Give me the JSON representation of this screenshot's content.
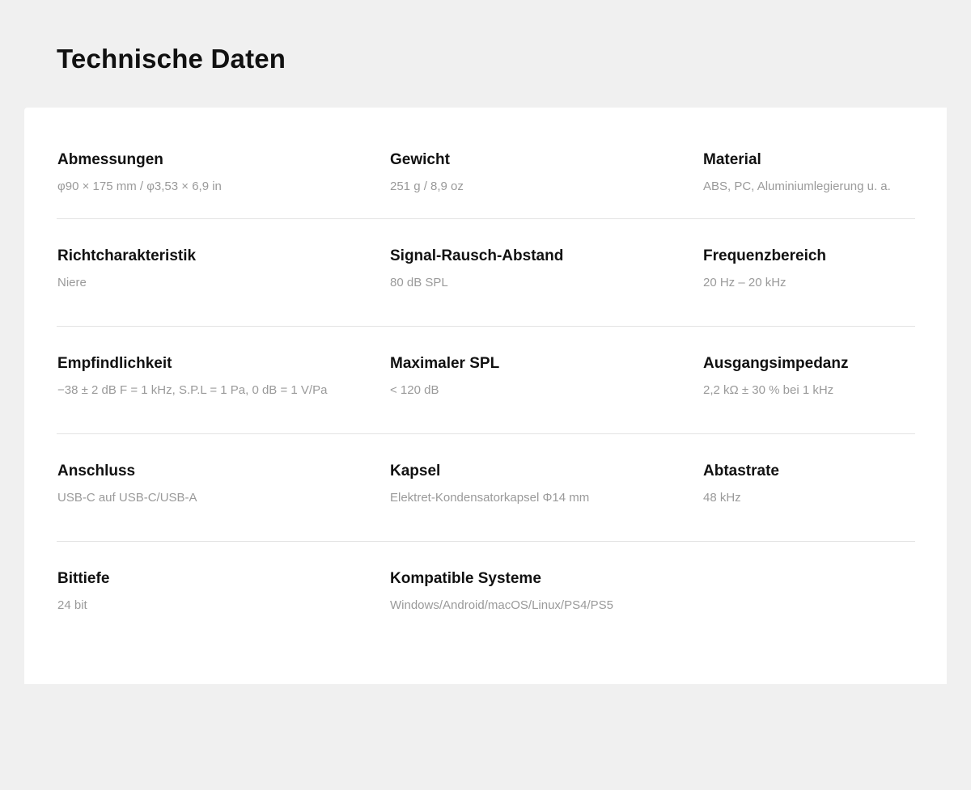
{
  "page_title": "Technische Daten",
  "specs": [
    [
      {
        "label": "Abmessungen",
        "value": "φ90 × 175 mm / φ3,53 × 6,9 in"
      },
      {
        "label": "Gewicht",
        "value": "251 g / 8,9 oz"
      },
      {
        "label": "Material",
        "value": "ABS, PC, Aluminiumlegierung u. a."
      }
    ],
    [
      {
        "label": "Richtcharakteristik",
        "value": "Niere"
      },
      {
        "label": "Signal-Rausch-Abstand",
        "value": "80 dB SPL"
      },
      {
        "label": "Frequenzbereich",
        "value": "20 Hz – 20 kHz"
      }
    ],
    [
      {
        "label": "Empfindlichkeit",
        "value": "−38 ± 2 dB F = 1 kHz, S.P.L = 1 Pa, 0 dB = 1 V/Pa"
      },
      {
        "label": "Maximaler SPL",
        "value": "< 120 dB"
      },
      {
        "label": "Ausgangsimpedanz",
        "value": "2,2 kΩ ± 30 % bei 1 kHz"
      }
    ],
    [
      {
        "label": "Anschluss",
        "value": "USB-C auf USB-C/USB-A"
      },
      {
        "label": "Kapsel",
        "value": "Elektret-Kondensatorkapsel Φ14 mm"
      },
      {
        "label": "Abtastrate",
        "value": "48 kHz"
      }
    ],
    [
      {
        "label": "Bittiefe",
        "value": "24 bit"
      },
      {
        "label": "Kompatible Systeme",
        "value": "Windows/Android/macOS/Linux/PS4/PS5"
      }
    ]
  ]
}
